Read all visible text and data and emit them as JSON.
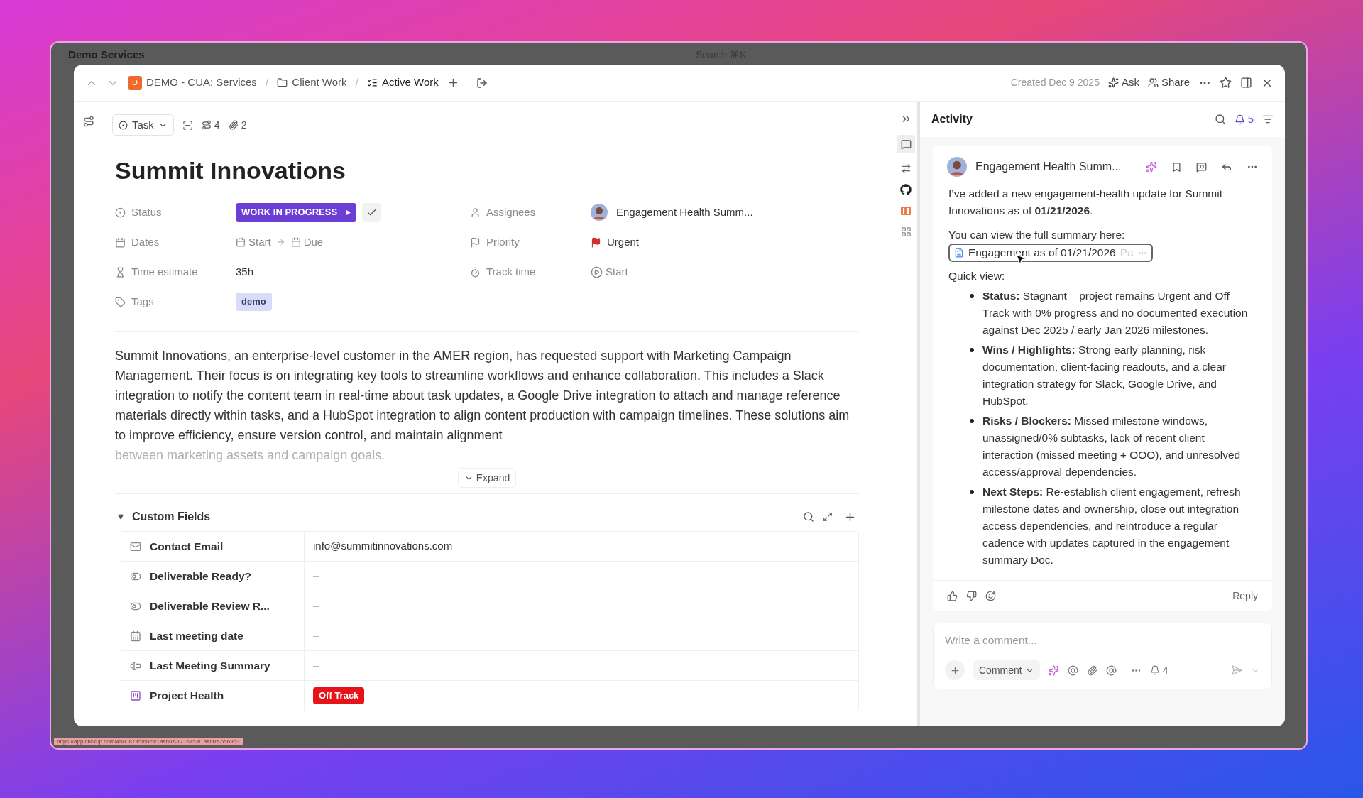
{
  "background_app": {
    "workspace": "Demo Services",
    "search": "Search ⌘K"
  },
  "breadcrumb_separator": "/",
  "breadcrumb": [
    {
      "kind": "space",
      "label": "DEMO - CUA: Services",
      "badge": "D"
    },
    {
      "kind": "folder",
      "label": "Client Work"
    },
    {
      "kind": "list",
      "label": "Active Work"
    }
  ],
  "header": {
    "created": "Created Dec 9 2025",
    "ask": "Ask",
    "share": "Share"
  },
  "task": {
    "type": "Task",
    "subtasks": "4",
    "attachments": "2",
    "title": "Summit Innovations",
    "status": {
      "label": "Status",
      "value": "WORK IN PROGRESS",
      "color": "#6b3fd6"
    },
    "dates": {
      "label": "Dates",
      "start": "Start",
      "due": "Due"
    },
    "time_estimate": {
      "label": "Time estimate",
      "value": "35h"
    },
    "tags": {
      "label": "Tags",
      "items": [
        {
          "label": "demo",
          "color": "#d9dcf7"
        }
      ]
    },
    "assignees": {
      "label": "Assignees",
      "name": "Engagement Health Summ..."
    },
    "priority": {
      "label": "Priority",
      "value": "Urgent",
      "color": "#d0312d"
    },
    "track_time": {
      "label": "Track time",
      "value": "Start"
    },
    "description": [
      "Summit Innovations, an enterprise-level customer in the AMER region, has requested support with Marketing Campaign Management. Their focus is on integrating key tools to streamline workflows and enhance collaboration. This includes a Slack integration to notify the content team in real-time about task updates, a Google Drive integration to attach and manage reference materials directly within tasks, and a HubSpot integration to align content production with campaign timelines. These solutions aim to improve efficiency, ensure version control, and maintain alignment",
      "between marketing assets and campaign goals."
    ],
    "expand": "Expand"
  },
  "custom_fields": {
    "title": "Custom Fields",
    "expanded": true,
    "rows": [
      {
        "kind": "email",
        "name": "Contact Email",
        "value": "info@summitinnovations.com"
      },
      {
        "kind": "toggle",
        "name": "Deliverable Ready?",
        "value": "–"
      },
      {
        "kind": "toggle",
        "name": "Deliverable Review R...",
        "value": "–"
      },
      {
        "kind": "date",
        "name": "Last meeting date",
        "value": "–"
      },
      {
        "kind": "text",
        "name": "Last Meeting Summary",
        "value": "–"
      },
      {
        "kind": "label",
        "name": "Project Health",
        "value": "Off Track",
        "color": "#e5141b"
      }
    ]
  },
  "activity": {
    "title": "Activity",
    "notifications": "5",
    "comment": {
      "author": "Engagement Health Summ...",
      "paragraphs": [
        "I’ve added a new engagement-health update for Summit Innovations as of **01/21/2026**.",
        "You can view the full summary here:"
      ],
      "doc_link": {
        "title": "Engagement as of 01/21/2026",
        "faded": "Pa"
      },
      "quick_view": "Quick view:",
      "bullets": [
        "**Status:** Stagnant – project remains Urgent and Off Track with 0% progress and no documented execution against Dec 2025 / early Jan 2026 milestones.",
        "**Wins / Highlights:** Strong early planning, risk documentation, client-facing readouts, and a clear integration strategy for Slack, Google Drive, and HubSpot.",
        "**Risks / Blockers:** Missed milestone windows, unassigned/0% subtasks, lack of recent client interaction (missed meeting + OOO), and unresolved access/approval dependencies.",
        "**Next Steps:** Re-establish client engagement, refresh milestone dates and ownership, close out integration access dependencies, and reintroduce a regular cadence with updates captured in the engagement summary Doc."
      ],
      "reply": "Reply"
    },
    "composer": {
      "placeholder": "Write a comment...",
      "mode": "Comment",
      "watchers": "4"
    }
  },
  "status_url": "https://app.clickup.com/45008735/docs/1ashuz-1716153/1ashuz-656953"
}
